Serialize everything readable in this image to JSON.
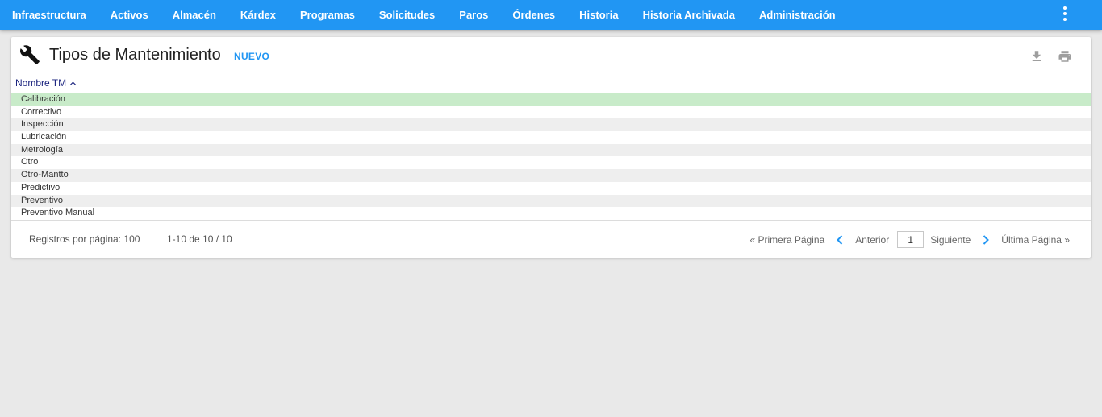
{
  "nav": {
    "items": [
      {
        "label": "Infraestructura"
      },
      {
        "label": "Activos"
      },
      {
        "label": "Almacén"
      },
      {
        "label": "Kárdex"
      },
      {
        "label": "Programas"
      },
      {
        "label": "Solicitudes"
      },
      {
        "label": "Paros"
      },
      {
        "label": "Órdenes"
      },
      {
        "label": "Historia"
      },
      {
        "label": "Historia Archivada"
      },
      {
        "label": "Administración"
      }
    ],
    "menu_icon": "more-vert-icon"
  },
  "header": {
    "icon": "wrench-icon",
    "title": "Tipos de Mantenimiento",
    "new_label": "NUEVO",
    "actions": [
      "download-icon",
      "print-icon"
    ]
  },
  "table": {
    "column_header": "Nombre TM",
    "sort": "ascending",
    "rows": [
      {
        "name": "Calibración",
        "selected": true
      },
      {
        "name": "Correctivo"
      },
      {
        "name": "Inspección"
      },
      {
        "name": "Lubricación"
      },
      {
        "name": "Metrología"
      },
      {
        "name": "Otro"
      },
      {
        "name": "Otro-Mantto"
      },
      {
        "name": "Predictivo"
      },
      {
        "name": "Preventivo"
      },
      {
        "name": "Preventivo Manual"
      }
    ]
  },
  "footer": {
    "per_page": "Registros por página: 100",
    "range": "1-10 de 10 / 10",
    "first_page": "« Primera Página",
    "previous": "Anterior",
    "page_value": "1",
    "next": "Siguiente",
    "last_page": "Última Página »"
  },
  "colors": {
    "primary": "#2196f3",
    "selected_row": "#c8ebc9",
    "striped_row": "#eeeeee",
    "header_text": "#1a237e"
  }
}
